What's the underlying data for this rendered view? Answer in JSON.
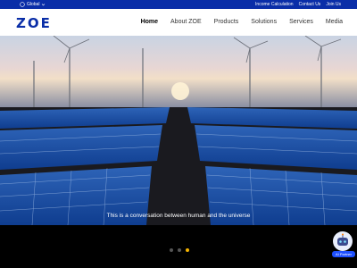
{
  "topbar": {
    "region_label": "Global",
    "links": [
      "Income Calculation",
      "Contact Us",
      "Join Us"
    ]
  },
  "navbar": {
    "logo_text": "ZOE",
    "items": [
      "Home",
      "About ZOE",
      "Products",
      "Solutions",
      "Services",
      "Media"
    ],
    "active_item": "Home"
  },
  "hero": {
    "caption": "This is a conversation between human and the universe",
    "carousel_active_index": 2,
    "carousel_count": 3
  },
  "assistant": {
    "label": "AI Partner"
  },
  "colors": {
    "brand_blue": "#0a2ea8",
    "carousel_active": "#f5b400"
  }
}
